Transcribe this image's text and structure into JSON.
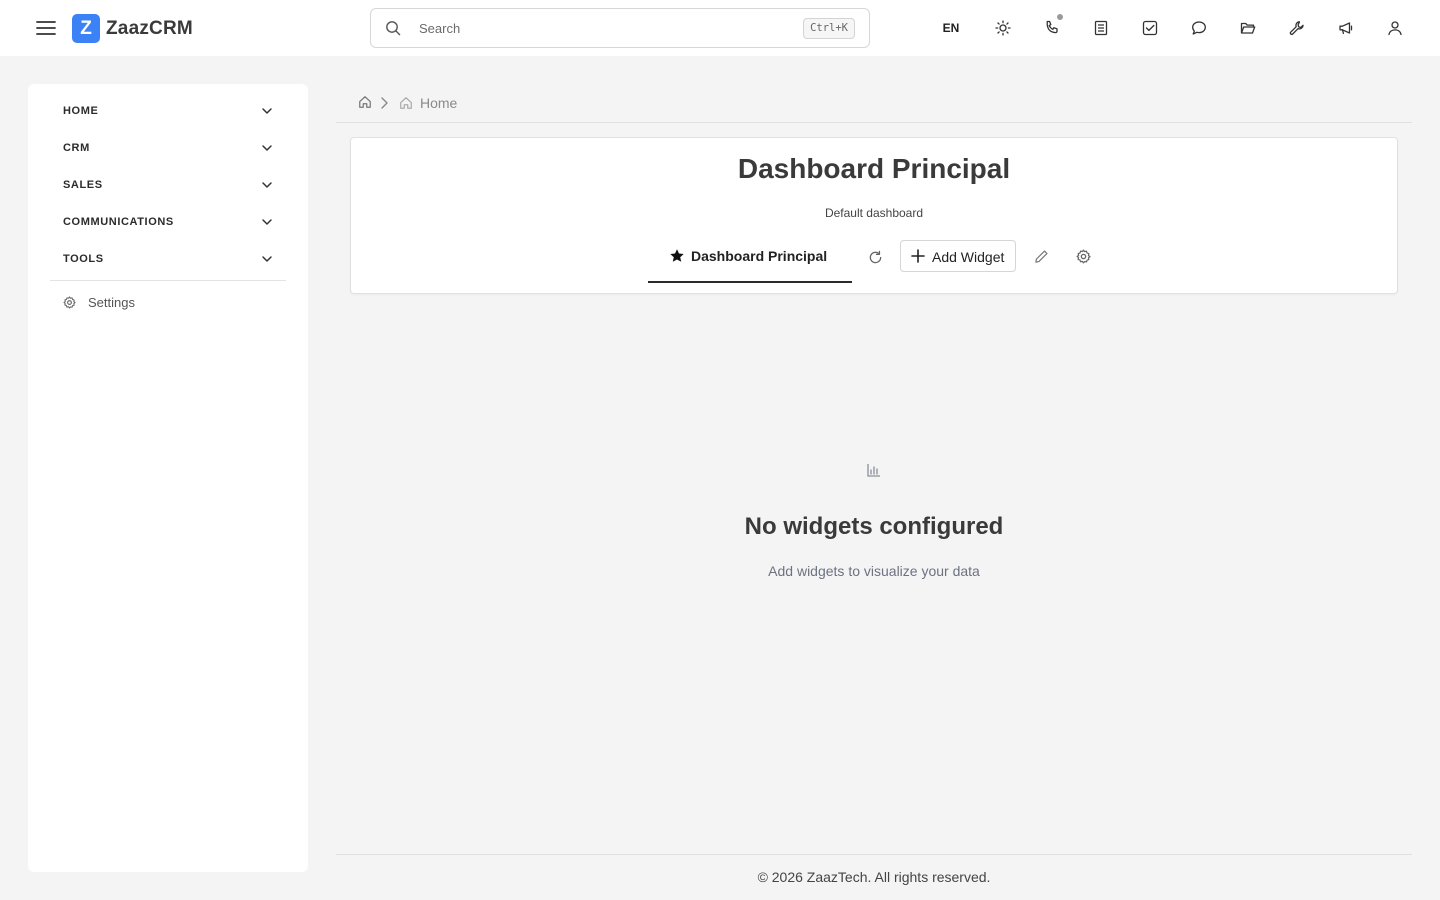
{
  "app": {
    "logo_letter": "Z",
    "name": "ZaazCRM",
    "accent": "#3b82f6"
  },
  "search": {
    "placeholder": "Search",
    "shortcut": "Ctrl+K"
  },
  "topbar": {
    "language": "EN",
    "icons": [
      "sun-icon",
      "phone-icon",
      "document-icon",
      "checkbox-icon",
      "chat-icon",
      "folder-icon",
      "wrench-icon",
      "megaphone-icon",
      "user-icon"
    ]
  },
  "sidebar": {
    "items": [
      {
        "label": "HOME"
      },
      {
        "label": "CRM"
      },
      {
        "label": "SALES"
      },
      {
        "label": "COMMUNICATIONS"
      },
      {
        "label": "TOOLS"
      }
    ],
    "settings_label": "Settings"
  },
  "breadcrumb": {
    "current": "Home"
  },
  "dashboard": {
    "title": "Dashboard Principal",
    "subtitle": "Default dashboard",
    "tab_label": "Dashboard Principal",
    "add_widget_label": "Add Widget"
  },
  "empty_state": {
    "title": "No widgets configured",
    "subtitle": "Add widgets to visualize your data"
  },
  "footer": {
    "text": "© 2026 ZaazTech. All rights reserved."
  }
}
